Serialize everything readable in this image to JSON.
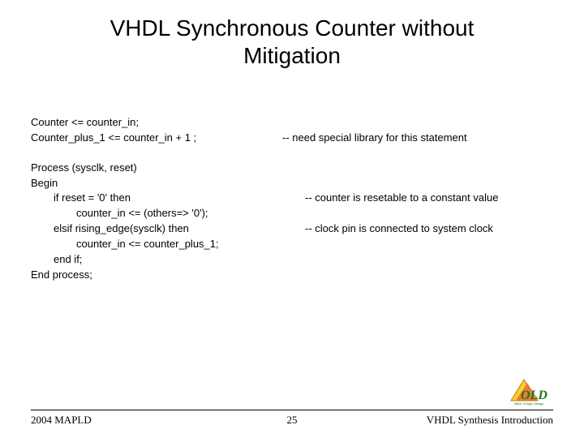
{
  "title_line1": "VHDL Synchronous Counter without",
  "title_line2": "Mitigation",
  "lines": {
    "l1_left": "Counter <= counter_in;",
    "l2_left": "Counter_plus_1 <= counter_in + 1 ;",
    "l2_comment": "-- need special library for this statement",
    "l3_left": "Process (sysclk, reset)",
    "l4_left": "Begin",
    "l5_left": "if reset = '0' then",
    "l5_comment": "-- counter is resetable to a constant value",
    "l6_left": "counter_in <= (others=> '0');",
    "l7_left": "elsif rising_edge(sysclk) then",
    "l7_comment": "-- clock pin is connected to system clock",
    "l8_left": "counter_in <= counter_plus_1;",
    "l9_left": "end if;",
    "l10_left": "End process;"
  },
  "footer": {
    "left": "2004 MAPLD",
    "center": "25",
    "right": "VHDL Synthesis Introduction"
  }
}
